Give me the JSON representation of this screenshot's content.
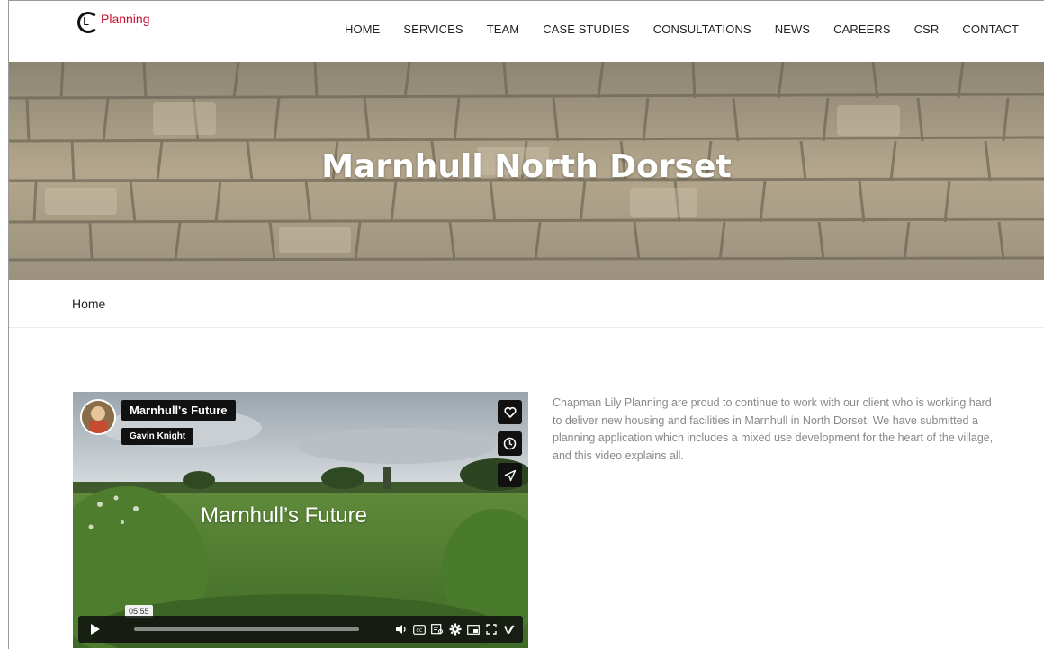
{
  "header": {
    "logo_letter": "L",
    "logo_text": "Planning",
    "nav": [
      {
        "label": "HOME"
      },
      {
        "label": "SERVICES"
      },
      {
        "label": "TEAM"
      },
      {
        "label": "CASE STUDIES"
      },
      {
        "label": "CONSULTATIONS"
      },
      {
        "label": "NEWS"
      },
      {
        "label": "CAREERS"
      },
      {
        "label": "CSR"
      },
      {
        "label": "CONTACT"
      }
    ]
  },
  "hero": {
    "title": "Marnhull North Dorset"
  },
  "breadcrumb": {
    "label": "Home"
  },
  "video": {
    "title": "Marnhull's Future",
    "author": "Gavin Knight",
    "overlay_text": "Marnhull’s Future",
    "time": "05:55",
    "side_buttons": [
      "heart-icon",
      "clock-icon",
      "send-icon"
    ],
    "control_icons": [
      "volume-icon",
      "captions-icon",
      "transcript-icon",
      "settings-icon",
      "pip-icon",
      "fullscreen-icon",
      "vimeo-icon"
    ],
    "progress": 0.0
  },
  "description": {
    "text": "Chapman Lily Planning are proud to continue to work with our client who is working hard to deliver new housing and facilities in Marnhull in North Dorset. We have submitted a planning application which includes a mixed use development for the heart of the village, and this video explains all."
  },
  "colors": {
    "logo_red": "#c8102e",
    "text_dark": "#222222",
    "text_muted": "#888888"
  }
}
